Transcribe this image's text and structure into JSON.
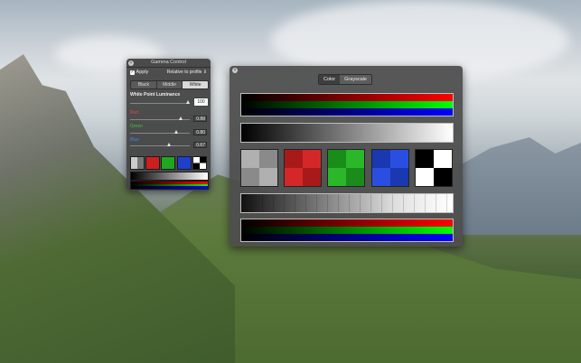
{
  "gamma_panel": {
    "title": "Gamma Control",
    "apply_label": "Apply",
    "apply_checked": true,
    "mode_label": "Relative to profile",
    "segments": [
      "Black",
      "Middle",
      "White"
    ],
    "selected_segment": "White",
    "white_point_label": "White Point Luminance",
    "white_point_value": "100",
    "sliders": [
      {
        "label": "Red",
        "value": "0.88",
        "color": "#e04848",
        "level": 0.88
      },
      {
        "label": "Green",
        "value": "0.80",
        "color": "#3cc43c",
        "level": 0.8
      },
      {
        "label": "Blue",
        "value": "0.67",
        "color": "#4a7ff0",
        "level": 0.67
      }
    ]
  },
  "color_window": {
    "tabs": [
      "Color",
      "Grayscale"
    ],
    "selected_tab": "Color"
  },
  "colors": {
    "panel_bg": "#424242",
    "red": "#cc1f1f",
    "green": "#1fa81f",
    "blue": "#1f3fcc"
  }
}
